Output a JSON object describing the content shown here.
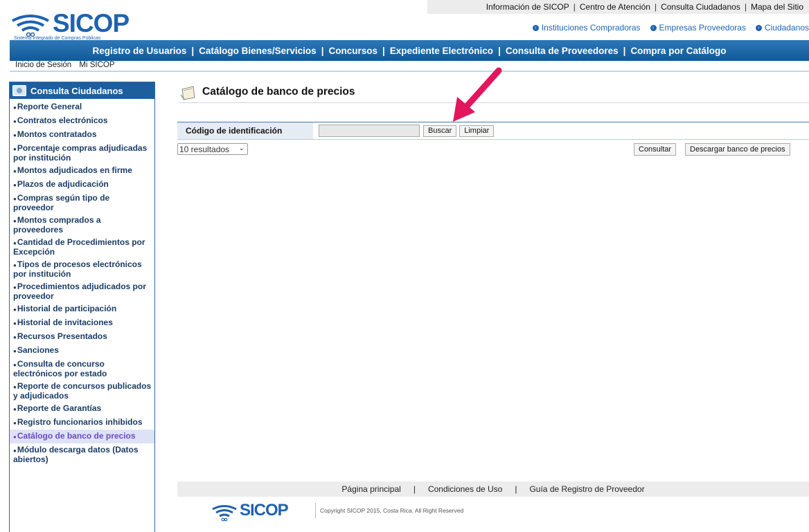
{
  "util_links": [
    "Información de SICOP",
    "Centro de Atención",
    "Consulta Ciudadanos",
    "Mapa del Sitio"
  ],
  "util_sep": "|",
  "logo": {
    "name": "SICOP",
    "subtitle": "Sistema Integrado de Compras Públicas"
  },
  "roles": [
    "Instituciones Compradoras",
    "Empresas Proveedoras",
    "Ciudadanos"
  ],
  "main_nav": [
    "Registro de Usuarios",
    "Catálogo Bienes/Servicios",
    "Concursos",
    "Expediente Electrónico",
    "Consulta de Proveedores",
    "Compra por Catálogo"
  ],
  "sub_nav": [
    "Inicio de Sesión",
    "Mi SICOP"
  ],
  "sidebar": {
    "title": "Consulta Ciudadanos",
    "items": [
      "Reporte General",
      "Contratos electrónicos",
      "Montos contratados",
      "Porcentaje compras adjudicadas por institución",
      "Montos adjudicados en firme",
      "Plazos de adjudicación",
      "Compras según tipo de proveedor",
      "Montos comprados a proveedores",
      "Cantidad de Procedimientos por Excepción",
      "Tipos de procesos electrónicos por institución",
      "Procedimientos adjudicados por proveedor",
      "Historial de participación",
      "Historial de invitaciones",
      "Recursos Presentados",
      "Sanciones",
      "Consulta de concurso electrónicos por estado",
      "Reporte de concursos publicados y adjudicados",
      "Reporte de Garantías",
      "Registro funcionarios inhibidos",
      "Catálogo de banco de precios",
      "Módulo descarga datos (Datos abiertos)"
    ],
    "active_index": 19
  },
  "page": {
    "title": "Catálogo de banco de precios",
    "search_label": "Código de identificación",
    "search_value": "",
    "buscar": "Buscar",
    "limpiar": "Limpiar",
    "results_select": "10 resultados",
    "consultar": "Consultar",
    "descargar": "Descargar banco de precios"
  },
  "footer": {
    "links": [
      "Página principal",
      "Condiciones de Uso",
      "Guía de Registro de Proveedor"
    ],
    "sep": "|",
    "logo": "SICOP",
    "copyright": "Copyright SICOP 2015, Costa Rica. All Right Reserved"
  },
  "colors": {
    "brand": "#1f62b0",
    "nav": "#1d5f9e",
    "arrow": "#e3155c",
    "active_item": "#6a4bc4"
  }
}
